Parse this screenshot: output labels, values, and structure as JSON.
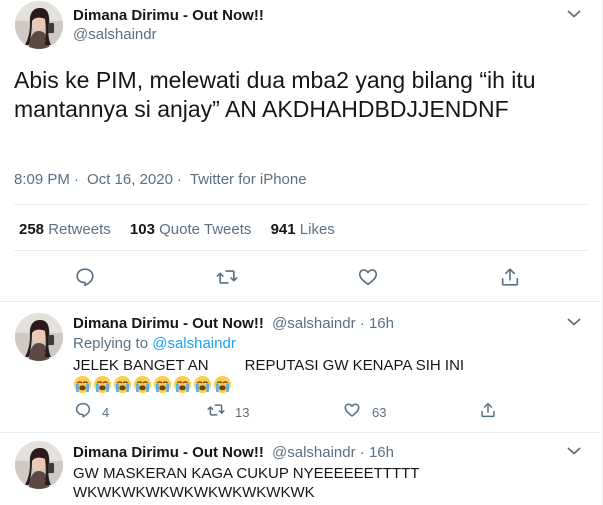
{
  "main_tweet": {
    "author_name": "Dimana Dirimu - Out Now!!",
    "author_handle": "@salshaindr",
    "text": "Abis ke PIM, melewati dua mba2 yang bilang “ih itu mantannya si anjay” AN AKDHAHDBDJJENDNF",
    "time": "8:09 PM",
    "date": "Oct 16, 2020",
    "source": "Twitter for iPhone",
    "separator": "·",
    "stats": {
      "retweets_count": "258",
      "retweets_label": "Retweets",
      "quote_count": "103",
      "quote_label": "Quote Tweets",
      "likes_count": "941",
      "likes_label": "Likes"
    },
    "icons": [
      "reply-icon",
      "retweet-icon",
      "like-icon",
      "share-icon"
    ]
  },
  "replies": [
    {
      "author_name": "Dimana Dirimu - Out Now!!",
      "author_handle": "@salshaindr",
      "separator": "·",
      "time_ago": "16h",
      "replying_prefix": "Replying to",
      "replying_mention": "@salshaindr",
      "text_part1": "JELEK BANGET AN",
      "text_part2": "REPUTASI GW KENAPA SIH INI",
      "emoji_name": "loudly-crying-face-emoji",
      "emoji_count": 8,
      "reply_count": "4",
      "retweet_count": "13",
      "like_count": "63"
    },
    {
      "author_name": "Dimana Dirimu - Out Now!!",
      "author_handle": "@salshaindr",
      "separator": "·",
      "time_ago": "16h",
      "text_line1": "GW MASKERAN KAGA CUKUP NYEEEEEETTTTT",
      "text_line2": "WKWKWKWKWKWKWKWKWKWK"
    }
  ],
  "colors": {
    "primary_text": "#14171a",
    "secondary_text": "#5b7083",
    "link": "#1da1f2",
    "divider": "#e6ecf0"
  }
}
